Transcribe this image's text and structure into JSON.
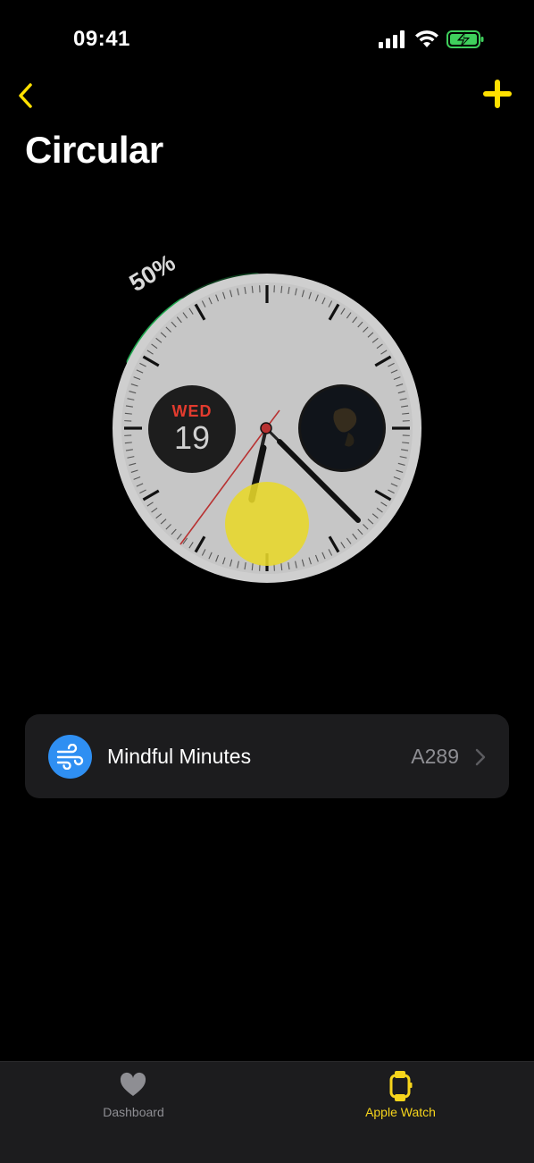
{
  "status_bar": {
    "time": "09:41"
  },
  "nav": {
    "back_icon": "chevron-left-icon",
    "add_icon": "plus-icon",
    "accent_color": "#FFE000"
  },
  "page": {
    "title": "Circular"
  },
  "watch_face": {
    "complication_percent_label": "50%",
    "complication_progress": 0.5,
    "date_day": "WED",
    "date_number": "19",
    "ring_color": "#1fa84f",
    "touch_indicator_color": "#e8d82a"
  },
  "list": {
    "items": [
      {
        "label": "Mindful Minutes",
        "value": "A289",
        "icon": "wind-icon",
        "icon_color": "#2f8ff2"
      }
    ]
  },
  "tab_bar": {
    "tabs": [
      {
        "label": "Dashboard",
        "icon": "heart-icon",
        "active": false
      },
      {
        "label": "Apple Watch",
        "icon": "watch-icon",
        "active": true
      }
    ],
    "active_color": "#f7d51c",
    "inactive_color": "#8e8e93"
  }
}
